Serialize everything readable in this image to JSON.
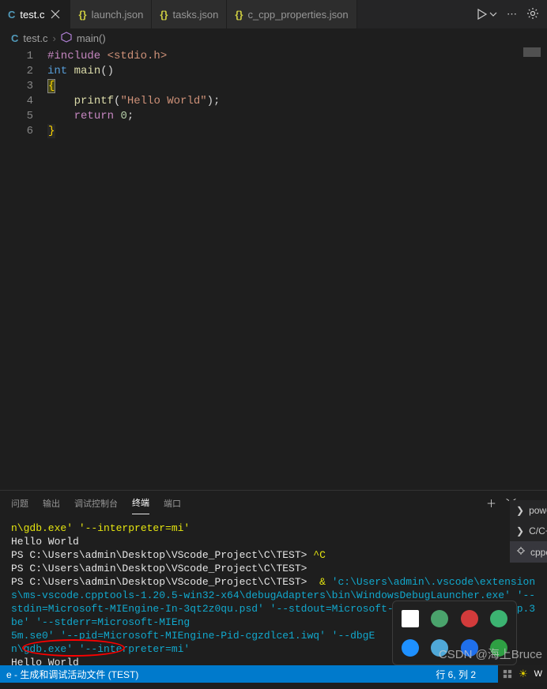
{
  "tabs": [
    {
      "label": "test.c",
      "iconKind": "c",
      "active": true
    },
    {
      "label": "launch.json",
      "iconKind": "json",
      "active": false
    },
    {
      "label": "tasks.json",
      "iconKind": "json",
      "active": false
    },
    {
      "label": "c_cpp_properties.json",
      "iconKind": "json",
      "active": false
    }
  ],
  "breadcrumbs": {
    "file_icon": "C",
    "file": "test.c",
    "symbol": "main()"
  },
  "code": {
    "lines": [
      {
        "n": "1",
        "segments": [
          {
            "t": "#include",
            "c": "include-dir"
          },
          {
            "t": " ",
            "c": ""
          },
          {
            "t": "<stdio.h>",
            "c": "include-path"
          }
        ]
      },
      {
        "n": "2",
        "segments": [
          {
            "t": "int",
            "c": "kw"
          },
          {
            "t": " ",
            "c": ""
          },
          {
            "t": "main",
            "c": "fn"
          },
          {
            "t": "()",
            "c": "paren"
          }
        ]
      },
      {
        "n": "3",
        "segments": [
          {
            "t": "{",
            "c": "brace brace-match"
          }
        ]
      },
      {
        "n": "4",
        "segments": [
          {
            "t": "    ",
            "c": ""
          },
          {
            "t": "printf",
            "c": "fn"
          },
          {
            "t": "(",
            "c": "paren"
          },
          {
            "t": "\"Hello World\"",
            "c": "str"
          },
          {
            "t": ");",
            "c": "paren"
          }
        ]
      },
      {
        "n": "5",
        "segments": [
          {
            "t": "    ",
            "c": ""
          },
          {
            "t": "return",
            "c": "include-dir"
          },
          {
            "t": " ",
            "c": ""
          },
          {
            "t": "0",
            "c": "num"
          },
          {
            "t": ";",
            "c": "paren"
          }
        ]
      },
      {
        "n": "6",
        "segments": [
          {
            "t": "}",
            "c": "brace brace-match current-line"
          }
        ]
      }
    ]
  },
  "panel_tabs": {
    "problems": "问题",
    "output": "输出",
    "debug_console": "调试控制台",
    "terminal": "终端",
    "ports": "端口"
  },
  "terminal": [
    {
      "c": "t-yellow",
      "t": "n\\gdb.exe' '--interpreter=mi'"
    },
    {
      "c": "t-white",
      "t": "Hello World"
    },
    {
      "c": "t-white",
      "t": "PS C:\\Users\\admin\\Desktop\\VScode_Project\\C\\TEST> "
    },
    {
      "c": "t-yellow",
      "t": "^C",
      "prefix": {
        "c": "t-white",
        "t": "PS C:\\Users\\admin\\Desktop\\VScode_Project\\C\\TEST> "
      }
    },
    {
      "c": "t-white",
      "t": "PS C:\\Users\\admin\\Desktop\\VScode_Project\\C\\TEST>"
    },
    {
      "c": "t-white",
      "t": "PS C:\\Users\\admin\\Desktop\\VScode_Project\\C\\TEST>  "
    },
    {
      "c": "t-yellow",
      "t": "& 'c:\\Users\\admin\\.vscode\\extensions\\ms-vscode.cpptools-1.20.5-win32-x64\\debugAdapters\\bin\\WindowsDebugLauncher.exe' '--stdin=Microsoft-MIEngine-In-3qt2z0qu.psd' '--stdout=Microsoft-MIEngine-Out-fv4l2pvp.3be' '--stderr=Microsoft-MIEngine-xxxxx5m.se0' '--pid=Microsoft-MIEngine-Pid-cgzdlce1.iwq' '--dbgExe=xxxx\\gdb.exe' '--interpreter=mi'"
    },
    {
      "c": "t-white",
      "t": "Hello World"
    },
    {
      "c": "t-white",
      "t": "PS C:\\Users\\admin\\Desktop\\VScode_Project\\C\\TEST>"
    }
  ],
  "right_panel": {
    "items": [
      {
        "label": "powe",
        "icon": "terminal"
      },
      {
        "label": "C/C+",
        "icon": "terminal"
      },
      {
        "label": "cppc",
        "icon": "debug",
        "selected": true
      }
    ]
  },
  "status_bar": {
    "left_truncated": "e - 生成和调试活动文件 (TEST)",
    "cursor": "行 6, 列 2"
  },
  "watermark": "CSDN @海上Bruce",
  "tray_icons": [
    {
      "bg": "#ffffff"
    },
    {
      "bg": "#4aa36c"
    },
    {
      "bg": "#d23b3b"
    },
    {
      "bg": "#3cb371"
    },
    {
      "bg": "#1e90ff"
    },
    {
      "bg": "#4fa8d8"
    },
    {
      "bg": "#1f6feb"
    },
    {
      "bg": "#2ea043"
    }
  ]
}
